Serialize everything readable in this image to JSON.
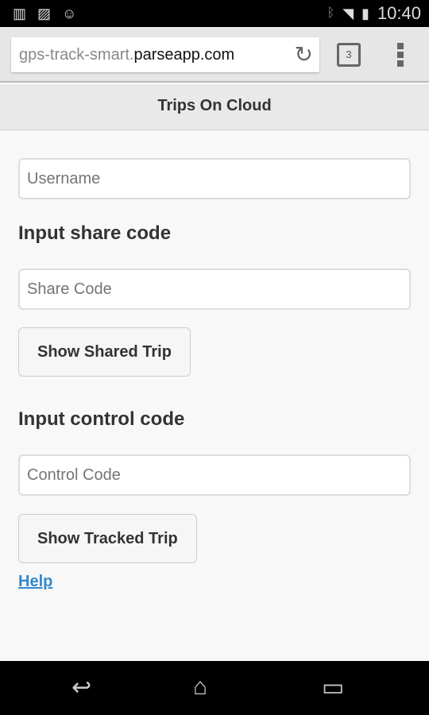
{
  "status_bar": {
    "time": "10:40",
    "icons": [
      "barcode-icon",
      "image-icon",
      "chat-icon",
      "bluetooth-icon",
      "wifi-icon",
      "signal-icon",
      "battery-icon"
    ]
  },
  "browser": {
    "url_dim": "gps-track-smart.",
    "url_domain": "parseapp.com",
    "tab_count": "3"
  },
  "header": {
    "title": "Trips On Cloud"
  },
  "form": {
    "username_placeholder": "Username",
    "share_heading": "Input share code",
    "share_placeholder": "Share Code",
    "share_button": "Show Shared Trip",
    "control_heading": "Input control code",
    "control_placeholder": "Control Code",
    "control_button": "Show Tracked Trip",
    "help_link": "Help"
  },
  "colors": {
    "link": "#3388cc"
  }
}
